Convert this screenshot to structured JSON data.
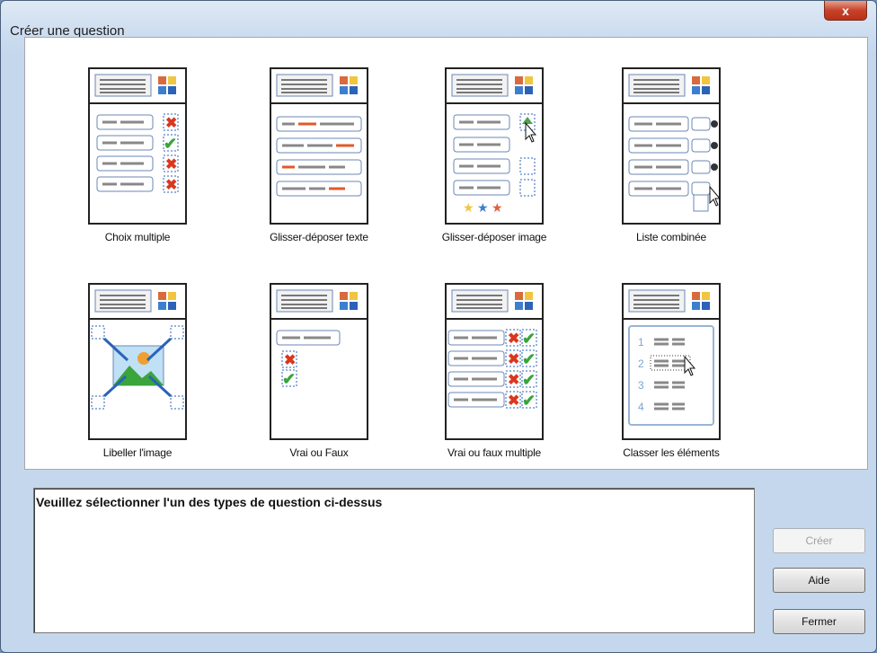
{
  "window": {
    "title": "Créer une question",
    "close_label": "x"
  },
  "question_types": [
    {
      "label": "Choix multiple"
    },
    {
      "label": "Glisser-déposer texte"
    },
    {
      "label": "Glisser-déposer image"
    },
    {
      "label": "Liste combinée"
    },
    {
      "label": "Libeller l'image"
    },
    {
      "label": "Vrai ou Faux"
    },
    {
      "label": "Vrai ou faux multiple"
    },
    {
      "label": "Classer les éléments"
    }
  ],
  "description": {
    "text": "Veuillez sélectionner l'un des types de question ci-dessus"
  },
  "buttons": {
    "create": "Créer",
    "help": "Aide",
    "close": "Fermer"
  },
  "colors": {
    "red_mark": "#d9381e",
    "green_mark": "#3aa53a",
    "accent_blue": "#2a63b8"
  }
}
